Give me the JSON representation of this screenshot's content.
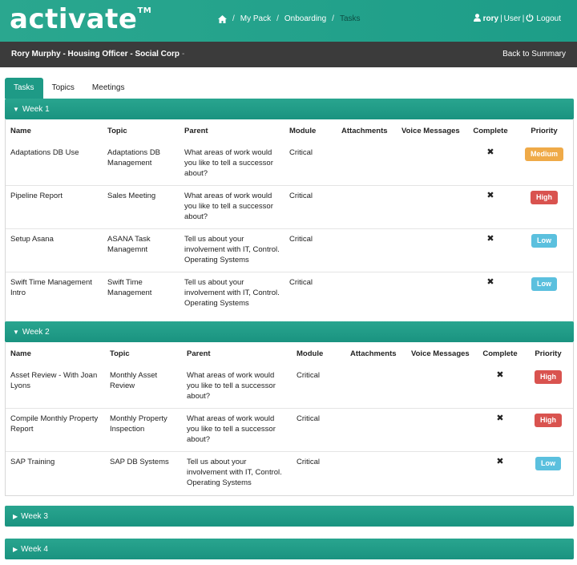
{
  "app": {
    "logo": "activate",
    "trademark": "TM"
  },
  "breadcrumb": [
    {
      "label": "My Pack"
    },
    {
      "label": "Onboarding"
    },
    {
      "label": "Tasks"
    }
  ],
  "user": {
    "name": "rory",
    "role": "User",
    "logout": "Logout"
  },
  "subbar": {
    "person": "Rory Murphy - Housing Officer - Social Corp",
    "caret": "-",
    "back": "Back to Summary"
  },
  "tabs": [
    {
      "label": "Tasks"
    },
    {
      "label": "Topics"
    },
    {
      "label": "Meetings"
    }
  ],
  "columns": [
    "Name",
    "Topic",
    "Parent",
    "Module",
    "Attachments",
    "Voice Messages",
    "Complete",
    "Priority"
  ],
  "weeks": [
    {
      "label": "Week 1",
      "rows": [
        {
          "name": "Adaptations DB Use",
          "topic": "Adaptations DB Management",
          "parent": "What areas of work would you like to tell a successor about?",
          "module": "Critical",
          "complete": "✖",
          "priority": "Medium"
        },
        {
          "name": "Pipeline Report",
          "topic": "Sales Meeting",
          "parent": "What areas of work would you like to tell a successor about?",
          "module": "Critical",
          "complete": "✖",
          "priority": "High"
        },
        {
          "name": "Setup Asana",
          "topic": "ASANA Task Managemnt",
          "parent": "Tell us about your involvement with IT, Control. Operating Systems",
          "module": "Critical",
          "complete": "✖",
          "priority": "Low"
        },
        {
          "name": "Swift Time Management Intro",
          "topic": "Swift Time Management",
          "parent": "Tell us about your involvement with IT, Control. Operating Systems",
          "module": "Critical",
          "complete": "✖",
          "priority": "Low"
        }
      ]
    },
    {
      "label": "Week 2",
      "rows": [
        {
          "name": "Asset Review - With Joan Lyons",
          "topic": "Monthly Asset Review",
          "parent": "What areas of work would you like to tell a successor about?",
          "module": "Critical",
          "complete": "✖",
          "priority": "High"
        },
        {
          "name": "Compile Monthly Property Report",
          "topic": "Monthly Property Inspection",
          "parent": "What areas of work would you like to tell a successor about?",
          "module": "Critical",
          "complete": "✖",
          "priority": "High"
        },
        {
          "name": "SAP Training",
          "topic": "SAP DB Systems",
          "parent": "Tell us about your involvement with IT, Control. Operating Systems",
          "module": "Critical",
          "complete": "✖",
          "priority": "Low"
        }
      ]
    },
    {
      "label": "Week 3",
      "rows": []
    },
    {
      "label": "Week 4",
      "rows": []
    }
  ],
  "colors": {
    "accent": "#1e9a86",
    "dark_bar": "#3b3b3b",
    "medium": "#efaa48",
    "high": "#d9534f",
    "low": "#5bc0de"
  }
}
